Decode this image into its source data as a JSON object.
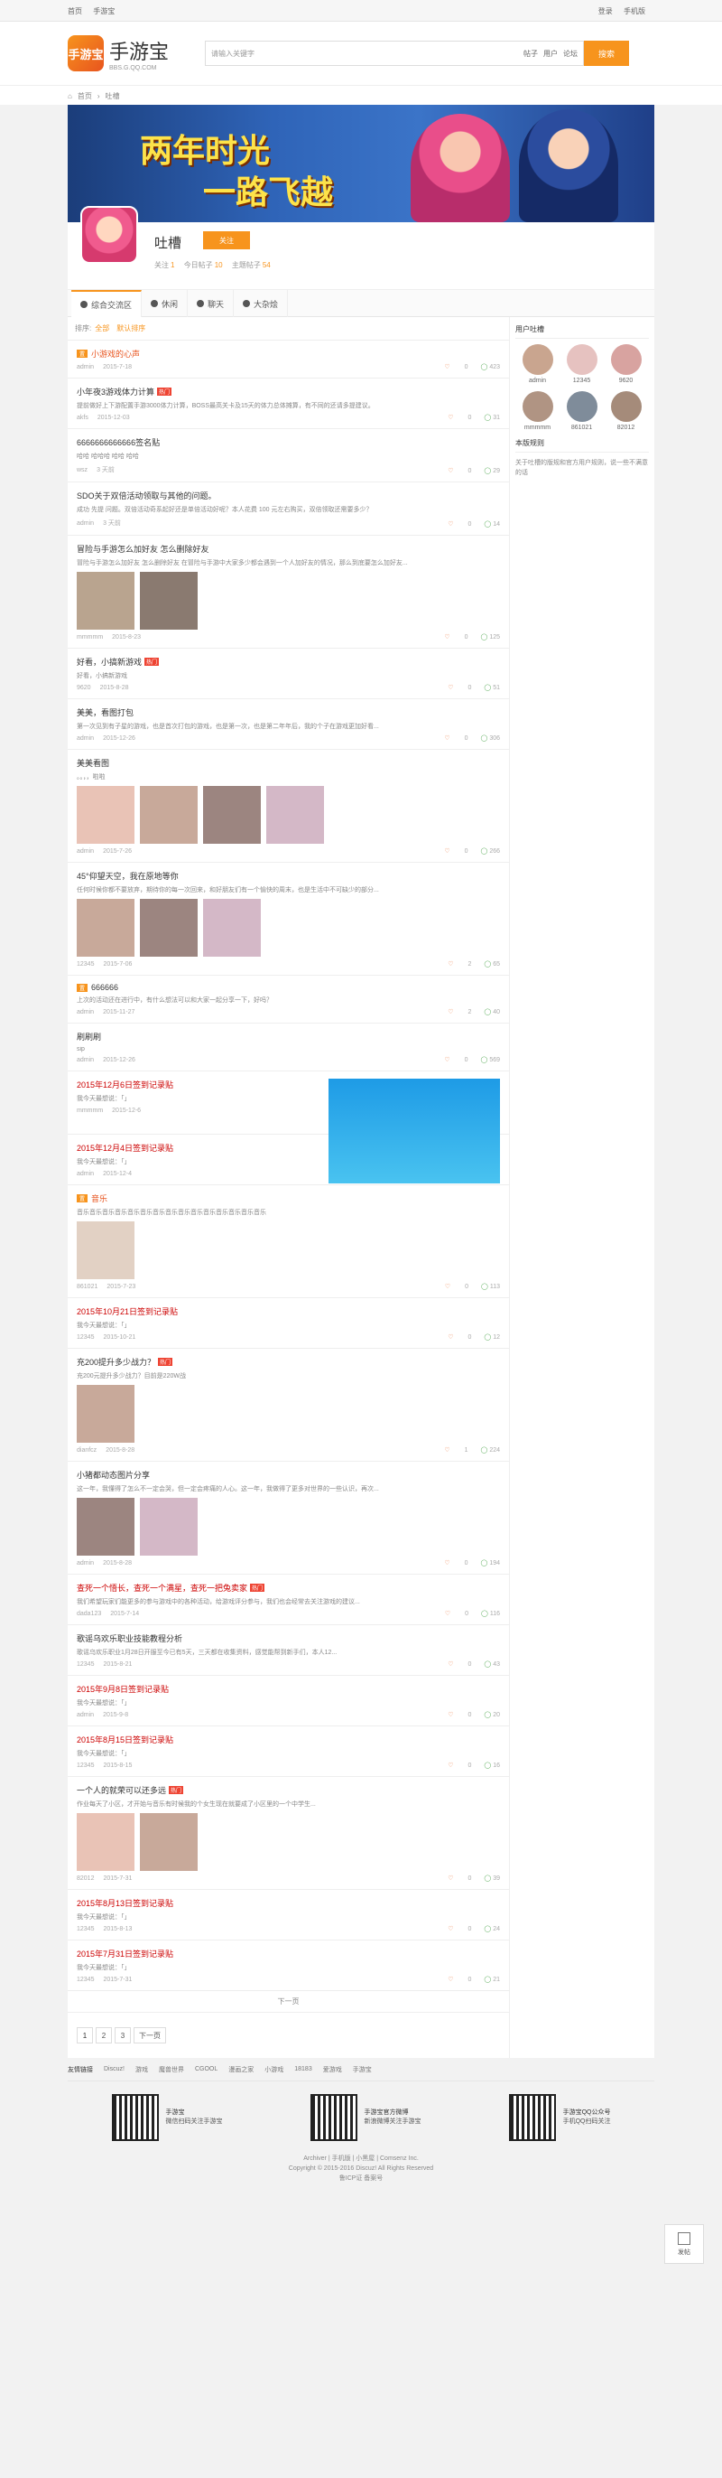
{
  "topbar": {
    "left": [
      "首页",
      "手游宝"
    ],
    "right": [
      "登录",
      "手机版"
    ]
  },
  "header": {
    "logo_mark": "手游宝",
    "logo_name": "手游宝",
    "logo_sub": "BBS.G.QQ.COM",
    "search_placeholder": "请输入关键字",
    "search_options": [
      "帖子",
      "用户",
      "论坛"
    ],
    "search_button": "搜索"
  },
  "breadcrumb": [
    "首页",
    "吐槽"
  ],
  "banner": {
    "line1": "两年时光",
    "line2": "一路飞越"
  },
  "forum": {
    "name": "吐槽",
    "follow": "关注",
    "stats": [
      {
        "label": "关注",
        "value": "1"
      },
      {
        "label": "今日帖子",
        "value": "10"
      },
      {
        "label": "主题帖子",
        "value": "54"
      }
    ]
  },
  "tabs": [
    "综合交流区",
    "休闲",
    "聊天",
    "大杂烩"
  ],
  "filter": {
    "label": "排序:",
    "sort": "全部",
    "order": "默认排序"
  },
  "threads": [
    {
      "tag": "置",
      "title": "小游戏的心声",
      "style": "orange",
      "excerpt": "",
      "author": "admin",
      "date": "2015-7-18",
      "likes": "0",
      "comments": "423"
    },
    {
      "title": "小年夜3游戏体力计算",
      "hot": "热门",
      "excerpt": "提前做好上下游配置手游3000体力计算，BOSS最高关卡及15天的体力总体摊算，有不同的还请多提建议。",
      "author": "akfs",
      "date": "2015-12-03",
      "likes": "0",
      "comments": "31"
    },
    {
      "title": "6666666666666签名贴",
      "excerpt": "哈哈 哈哈哈 哈哈 哈哈",
      "author": "wsz",
      "date": "3 天前",
      "likes": "0",
      "comments": "29"
    },
    {
      "title": "SDO关于双倍活动领取与其他的问题。",
      "excerpt": "成功 先提 问题。双倍活动奇系起好还是单倍活动好呢？本人花费 100 元左右购买，双倍领取还需要多少？",
      "author": "admin",
      "date": "3 天前",
      "likes": "0",
      "comments": "14"
    },
    {
      "title": "冒险与手游怎么加好友 怎么删除好友",
      "excerpt": "冒险与手游怎么加好友 怎么删除好友 在冒险与手游中大家多少都会遇到一个人加好友的情况，那么到底要怎么加好友...",
      "author": "mmmmm",
      "date": "2015-8-23",
      "likes": "0",
      "comments": "125",
      "images": 2
    },
    {
      "title": "好看，小搞新游戏",
      "hot": "热门",
      "excerpt": "好看，小搞新游戏",
      "author": "9620",
      "date": "2015-8-28",
      "likes": "0",
      "comments": "51"
    },
    {
      "title": "美美，看图打包",
      "excerpt": "第一次见到有子星的游戏，也是首次打包的游戏，也是第一次，也是第二年年后，我的个子在游戏更加好看...",
      "author": "admin",
      "date": "2015-12-26",
      "likes": "0",
      "comments": "306"
    },
    {
      "title": "美美看图",
      "excerpt": "。。，，啦啦",
      "author": "admin",
      "date": "2015-7-26",
      "likes": "0",
      "comments": "266",
      "images": 4
    },
    {
      "title": "45°仰望天空，我在原地等你",
      "excerpt": "任何时候你都不要放弃，期待你的每一次回来，和好朋友们有一个愉快的周末，也是生活中不可缺少的部分...",
      "author": "12345",
      "date": "2015-7-06",
      "likes": "2",
      "comments": "65",
      "images": 3
    },
    {
      "tag": "置",
      "title": "666666",
      "excerpt": "上次的活动还在进行中，有什么想法可以和大家一起分享一下，好吗？",
      "author": "admin",
      "date": "2015-11-27",
      "likes": "2",
      "comments": "40"
    },
    {
      "title": "刷刷刷",
      "excerpt": "sip",
      "author": "admin",
      "date": "2015-12-26",
      "likes": "0",
      "comments": "569"
    },
    {
      "title": "2015年12月6日签到记录贴",
      "style": "red",
      "excerpt": "我今天最想说：「」",
      "author": "mmmmm",
      "date": "2015-12-6",
      "likes": "",
      "comments": "",
      "right_image": true
    },
    {
      "title": "2015年12月4日签到记录贴",
      "style": "red",
      "excerpt": "我今天最想说：「」",
      "author": "admin",
      "date": "2015-12-4",
      "likes": "",
      "comments": ""
    },
    {
      "tag": "置",
      "title": "音乐",
      "style": "orange",
      "excerpt": "音乐音乐音乐音乐音乐音乐音乐音乐音乐音乐音乐音乐音乐音乐音乐",
      "author": "861021",
      "date": "2015-7-23",
      "likes": "0",
      "comments": "113",
      "images": 1
    },
    {
      "title": "2015年10月21日签到记录贴",
      "style": "red",
      "excerpt": "我今天最想说：「」",
      "author": "12345",
      "date": "2015-10-21",
      "likes": "0",
      "comments": "12"
    },
    {
      "title": "充200提升多少战力？",
      "hot": "热门",
      "excerpt": "充200元提升多少战力？目前是220W战",
      "author": "dianfcz",
      "date": "2015-8-28",
      "likes": "1",
      "comments": "224",
      "images": 1
    },
    {
      "title": "小猪都动态图片分享",
      "excerpt": "这一年，我懂得了怎么不一定会哭，但一定会疼痛的人心。这一年，我做得了更多对世界的一些认识，再次...",
      "author": "admin",
      "date": "2015-8-28",
      "likes": "0",
      "comments": "194",
      "images": 2
    },
    {
      "title": "查死一个悟长，查死一个满星，查死一把兔卖家",
      "hot": "热门",
      "style": "red",
      "excerpt": "我们希望玩家们能更多的参与游戏中的各种活动，给游戏评分参与，我们也会经常去关注游戏的建议...",
      "author": "dada123",
      "date": "2015-7-14",
      "likes": "0",
      "comments": "116"
    },
    {
      "title": "歌谣乌欢乐职业技能教程分析",
      "excerpt": "歌谣乌欢乐职业1月28日开服至今已有5天，三天都在收集资料，感觉能帮到新手们，本人12...",
      "author": "12345",
      "date": "2015-8-21",
      "likes": "0",
      "comments": "43"
    },
    {
      "title": "2015年9月8日签到记录贴",
      "style": "red",
      "excerpt": "我今天最想说：「」",
      "author": "admin",
      "date": "2015-9-8",
      "likes": "0",
      "comments": "20"
    },
    {
      "title": "2015年8月15日签到记录贴",
      "style": "red",
      "excerpt": "我今天最想说：「」",
      "author": "12345",
      "date": "2015-8-15",
      "likes": "0",
      "comments": "16"
    },
    {
      "title": "一个人的就荣可以还多远",
      "hot": "热门",
      "excerpt": "作业每天了小区，才开始与音乐有时候我的个女生现在就要成了小区里的一个中学生...",
      "author": "82012",
      "date": "2015-7-31",
      "likes": "0",
      "comments": "39",
      "images": 2
    },
    {
      "title": "2015年8月13日签到记录贴",
      "style": "red",
      "excerpt": "我今天最想说：「」",
      "author": "12345",
      "date": "2015-8-13",
      "likes": "0",
      "comments": "24"
    },
    {
      "title": "2015年7月31日签到记录贴",
      "style": "red",
      "excerpt": "我今天最想说：「」",
      "author": "12345",
      "date": "2015-7-31",
      "likes": "0",
      "comments": "21"
    }
  ],
  "more_label": "下一页",
  "pager": [
    "1",
    "2",
    "3",
    "下一页"
  ],
  "side": {
    "users_title": "用户吐槽",
    "users": [
      "admin",
      "12345",
      "9620",
      "mmmmm",
      "861021",
      "82012"
    ],
    "rules_title": "本版规则",
    "rules_text": "关于吐槽的版规和官方用户规则，说一些不满意的话"
  },
  "float_btn": "发帖",
  "footer": {
    "friends_label": "友情链接",
    "friends": [
      "Discuz!",
      "游戏",
      "魔兽世界",
      "CGOOL",
      "漫画之家",
      "小游戏",
      "18183",
      "爱游戏",
      "手游宝"
    ],
    "qrs": [
      {
        "title": "手游宝",
        "sub": "微信扫码关注手游宝"
      },
      {
        "title": "手游宝官方微博",
        "sub": "新浪微博关注手游宝"
      },
      {
        "title": "手游宝QQ公众号",
        "sub": "手机QQ扫码关注"
      }
    ],
    "copy1": "Archiver | 手机版 | 小黑屋 | Comsenz Inc.",
    "copy2": "Copyright © 2015-2016 Discuz! All Rights Reserved",
    "copy3": "鲁ICP证 备案号"
  },
  "colors": {
    "accent": "#f7941d",
    "hot": "#ee4433",
    "red_title": "#cc0000"
  }
}
